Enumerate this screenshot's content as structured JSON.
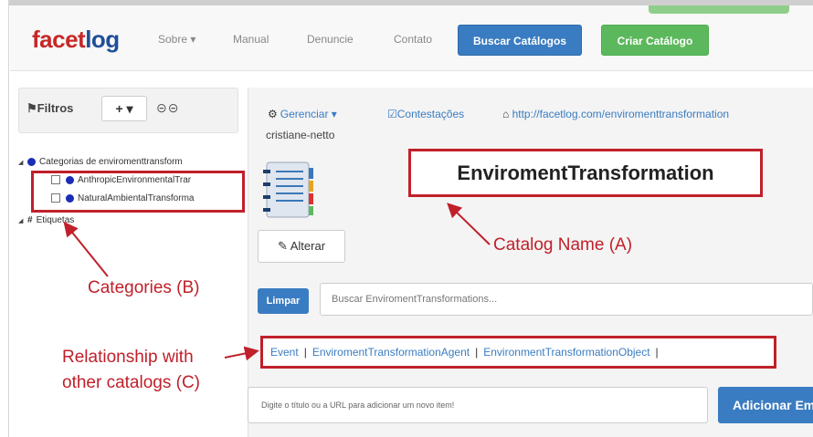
{
  "navbar": {
    "logo_part1": "facet",
    "logo_part2": "log",
    "links": [
      "Sobre ▾",
      "Manual",
      "Denuncie",
      "Contato"
    ],
    "search_catalogs_button": "Buscar Catálogos",
    "create_catalog_button": "Criar Catálogo"
  },
  "sidebar": {
    "filters_label": "Filtros",
    "plus_button": "+ ▾",
    "toggle_icons": "⊝⊝",
    "tree": {
      "categories_root": "Categorias de enviromenttransform",
      "children": [
        "AnthropicEnvironmentalTrar",
        "NaturalAmbientalTransforma"
      ],
      "labels_root": "Etiquetas"
    }
  },
  "main": {
    "manage_label": "Gerenciar ▾",
    "contestations_label": "Contestações",
    "catalog_url": "http://facetlog.com/enviromenttransformation",
    "username": "cristiane-netto",
    "catalog_name": "EnviromentTransformation",
    "edit_button": "Alterar",
    "clear_button": "Limpar",
    "search_placeholder": "Buscar EnviromentTransformations...",
    "relationships": [
      "Event",
      "EnviromentTransformationAgent",
      "EnvironmentTransformationObject"
    ],
    "add_item_placeholder": "Digite o título ou a URL para adicionar um novo item!",
    "add_button": "Adicionar Em"
  },
  "annotations": {
    "catalog_name": "Catalog Name (A)",
    "categories": "Categories (B)",
    "relationship_line1": "Relationship with",
    "relationship_line2": "other catalogs (C)"
  },
  "colors": {
    "accent_blue": "#3a7cc1",
    "create_green": "#5cb85c",
    "annotation_red": "#c0202a",
    "logo_red": "#c62828",
    "logo_blue": "#1f4f9a"
  }
}
